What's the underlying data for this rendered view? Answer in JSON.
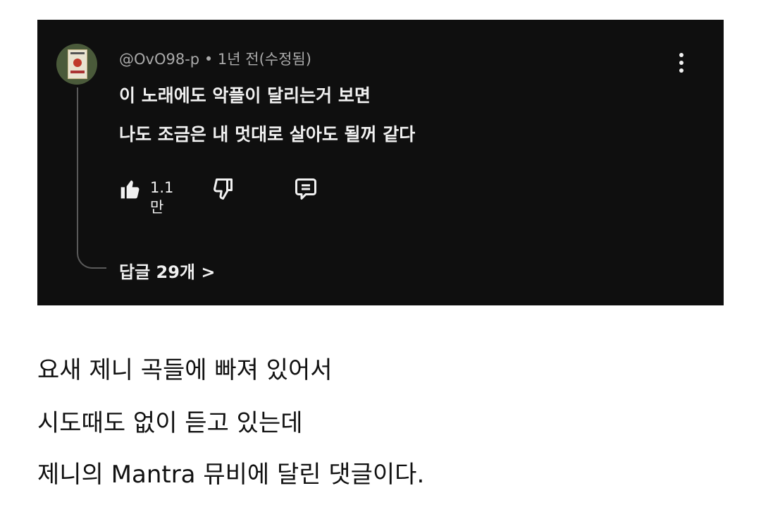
{
  "comment": {
    "handle": "@OvO98-p",
    "separator": "•",
    "time": "1년 전(수정됨)",
    "lines": [
      "이 노래에도 악플이 달리는거 보면",
      "나도 조금은 내 멋대로 살아도 될꺼 같다"
    ],
    "like_count": "1.1만",
    "replies_label": "답글 29개 >"
  },
  "caption": {
    "lines": [
      "요새 제니 곡들에 빠져 있어서",
      "시도때도 없이 듣고 있는데",
      "제니의 Mantra 뮤비에 달린 댓글이다."
    ]
  },
  "colors": {
    "card_bg": "#0f0f0f",
    "text_primary": "#f1f1f1",
    "text_secondary": "#aaaaaa",
    "page_bg": "#ffffff"
  },
  "icons": [
    "thumbs-up-icon",
    "thumbs-down-icon",
    "reply-icon",
    "more-vert-icon"
  ]
}
